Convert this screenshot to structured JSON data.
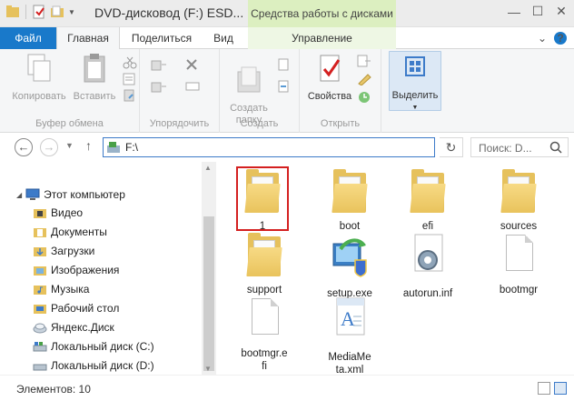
{
  "window": {
    "title": "DVD-дисковод (F:) ESD...",
    "context_header": "Средства работы с дисками",
    "colors": {
      "file_tab": "#1979ca",
      "context": "#dcefc0",
      "highlight": "#d42020"
    }
  },
  "tabs": {
    "file": "Файл",
    "home": "Главная",
    "share": "Поделиться",
    "view": "Вид",
    "manage": "Управление"
  },
  "ribbon": {
    "clipboard": {
      "copy": "Копировать",
      "paste": "Вставить",
      "label": "Буфер обмена"
    },
    "organize": {
      "label": "Упорядочить"
    },
    "create": {
      "new_folder": "Создать\nпапку",
      "label": "Создать"
    },
    "open": {
      "properties": "Свойства",
      "label": "Открыть"
    },
    "select": {
      "select": "Выделить"
    }
  },
  "address": {
    "path": "F:\\",
    "search_placeholder": "Поиск: D..."
  },
  "nav": {
    "items": [
      {
        "label": "Этот компьютер",
        "icon": "computer-icon"
      },
      {
        "label": "Видео",
        "icon": "video-folder-icon"
      },
      {
        "label": "Документы",
        "icon": "documents-folder-icon"
      },
      {
        "label": "Загрузки",
        "icon": "downloads-folder-icon"
      },
      {
        "label": "Изображения",
        "icon": "pictures-folder-icon"
      },
      {
        "label": "Музыка",
        "icon": "music-folder-icon"
      },
      {
        "label": "Рабочий стол",
        "icon": "desktop-folder-icon"
      },
      {
        "label": "Яндекс.Диск",
        "icon": "yandex-disk-icon"
      },
      {
        "label": "Локальный диск (C:)",
        "icon": "local-disk-icon"
      },
      {
        "label": "Локальный диск (D:)",
        "icon": "local-disk-icon"
      }
    ]
  },
  "files": [
    {
      "name": "1",
      "type": "folder"
    },
    {
      "name": "boot",
      "type": "folder"
    },
    {
      "name": "efi",
      "type": "folder"
    },
    {
      "name": "sources",
      "type": "folder"
    },
    {
      "name": "support",
      "type": "folder"
    },
    {
      "name": "setup.exe",
      "type": "setup"
    },
    {
      "name": "autorun.inf",
      "type": "config"
    },
    {
      "name": "bootmgr",
      "type": "file"
    },
    {
      "name": "bootmgr.efi",
      "type": "file"
    },
    {
      "name": "MediaMeta.xml",
      "type": "xml"
    }
  ],
  "status": {
    "count": "Элементов: 10"
  }
}
